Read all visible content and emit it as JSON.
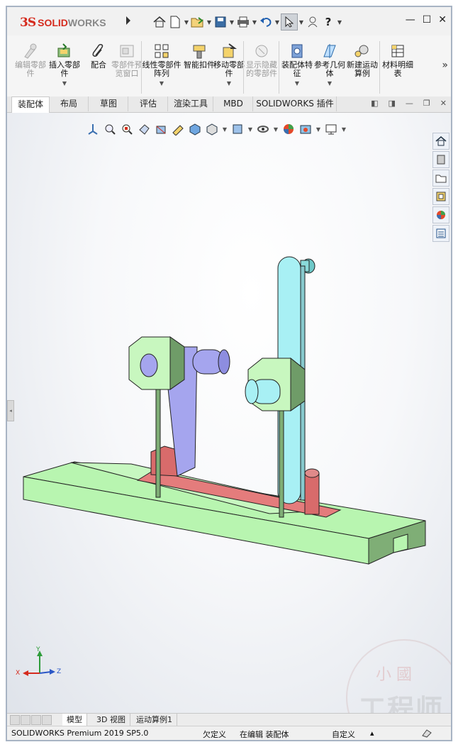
{
  "app": {
    "logo_ds": "3S",
    "logo_text_1": "SOLID",
    "logo_text_2": "WORKS"
  },
  "ribbon": {
    "buttons": [
      {
        "label": "编辑零部件",
        "enabled": false
      },
      {
        "label": "插入零部件",
        "enabled": true
      },
      {
        "label": "配合",
        "enabled": true
      },
      {
        "label": "零部件预览窗口",
        "enabled": false
      },
      {
        "label": "线性零部件阵列",
        "enabled": true
      },
      {
        "label": "智能扣件",
        "enabled": true
      },
      {
        "label": "移动零部件",
        "enabled": true
      },
      {
        "label": "显示隐藏的零部件",
        "enabled": false
      },
      {
        "label": "装配体特征",
        "enabled": true
      },
      {
        "label": "参考几何体",
        "enabled": true
      },
      {
        "label": "新建运动算例",
        "enabled": true
      },
      {
        "label": "材料明细表",
        "enabled": true
      }
    ],
    "more_icon": "»"
  },
  "tabs": [
    "装配体",
    "布局",
    "草图",
    "评估",
    "渲染工具",
    "MBD",
    "SOLIDWORKS 插件"
  ],
  "bottom_tabs": [
    "模型",
    "3D 视图",
    "运动算例1"
  ],
  "status": {
    "product": "SOLIDWORKS Premium 2019 SP5.0",
    "definition": "欠定义",
    "edit_mode": "在编辑 装配体",
    "units": "自定义",
    "units_caret": "▴"
  },
  "triad": {
    "x": "X",
    "y": "Y",
    "z": "Z"
  },
  "watermark": {
    "line1": "小 國",
    "line2": "工程师"
  },
  "colors": {
    "brand_red": "#d52b1e",
    "base_green": "#b8f5b0",
    "slider_red": "#e47c7c",
    "link_cyan": "#a8f0f4",
    "link_purple": "#a5a5ee"
  }
}
